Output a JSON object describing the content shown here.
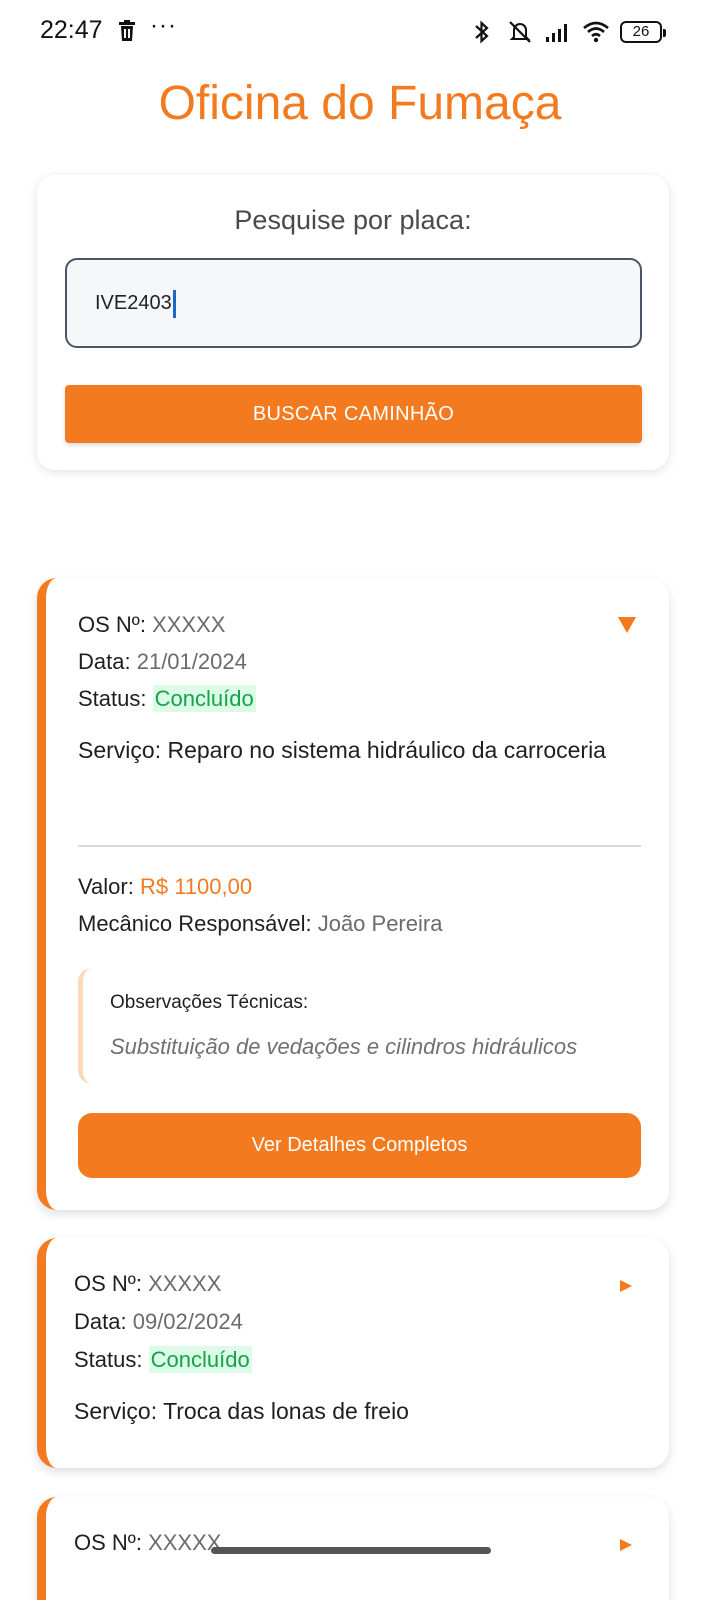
{
  "status_bar": {
    "time": "22:47",
    "dots": "···",
    "battery": "26",
    "icons": [
      "trash-icon",
      "bluetooth-icon",
      "mute-icon",
      "signal-icon",
      "wifi-icon",
      "battery-icon"
    ]
  },
  "app": {
    "title": "Oficina do Fumaça"
  },
  "search": {
    "label": "Pesquise por placa:",
    "value": "IVE2403",
    "button_label": "BUSCAR CAMINHÃO"
  },
  "labels": {
    "os": "OS Nº:",
    "data": "Data:",
    "status": "Status:",
    "servico": "Serviço:",
    "valor": "Valor:",
    "mecanico": "Mecânico Responsável:",
    "obs": "Observações Técnicas:",
    "details_button": "Ver Detalhes Completos"
  },
  "orders": [
    {
      "os": "XXXXX",
      "data": "21/01/2024",
      "status": "Concluído",
      "servico": "Reparo no sistema hidráulico da carroceria",
      "valor": "R$ 1100,00",
      "mecanico": "João Pereira",
      "obs": "Substituição de vedações e cilindros hidráulicos",
      "expanded": true
    },
    {
      "os": "XXXXX",
      "data": "09/02/2024",
      "status": "Concluído",
      "servico": "Troca das lonas de freio",
      "expanded": false
    },
    {
      "os": "XXXXX",
      "expanded": false
    }
  ],
  "colors": {
    "accent": "#f47a1f",
    "status_ok_bg": "#dcfce7",
    "status_ok_text": "#16a34a"
  }
}
